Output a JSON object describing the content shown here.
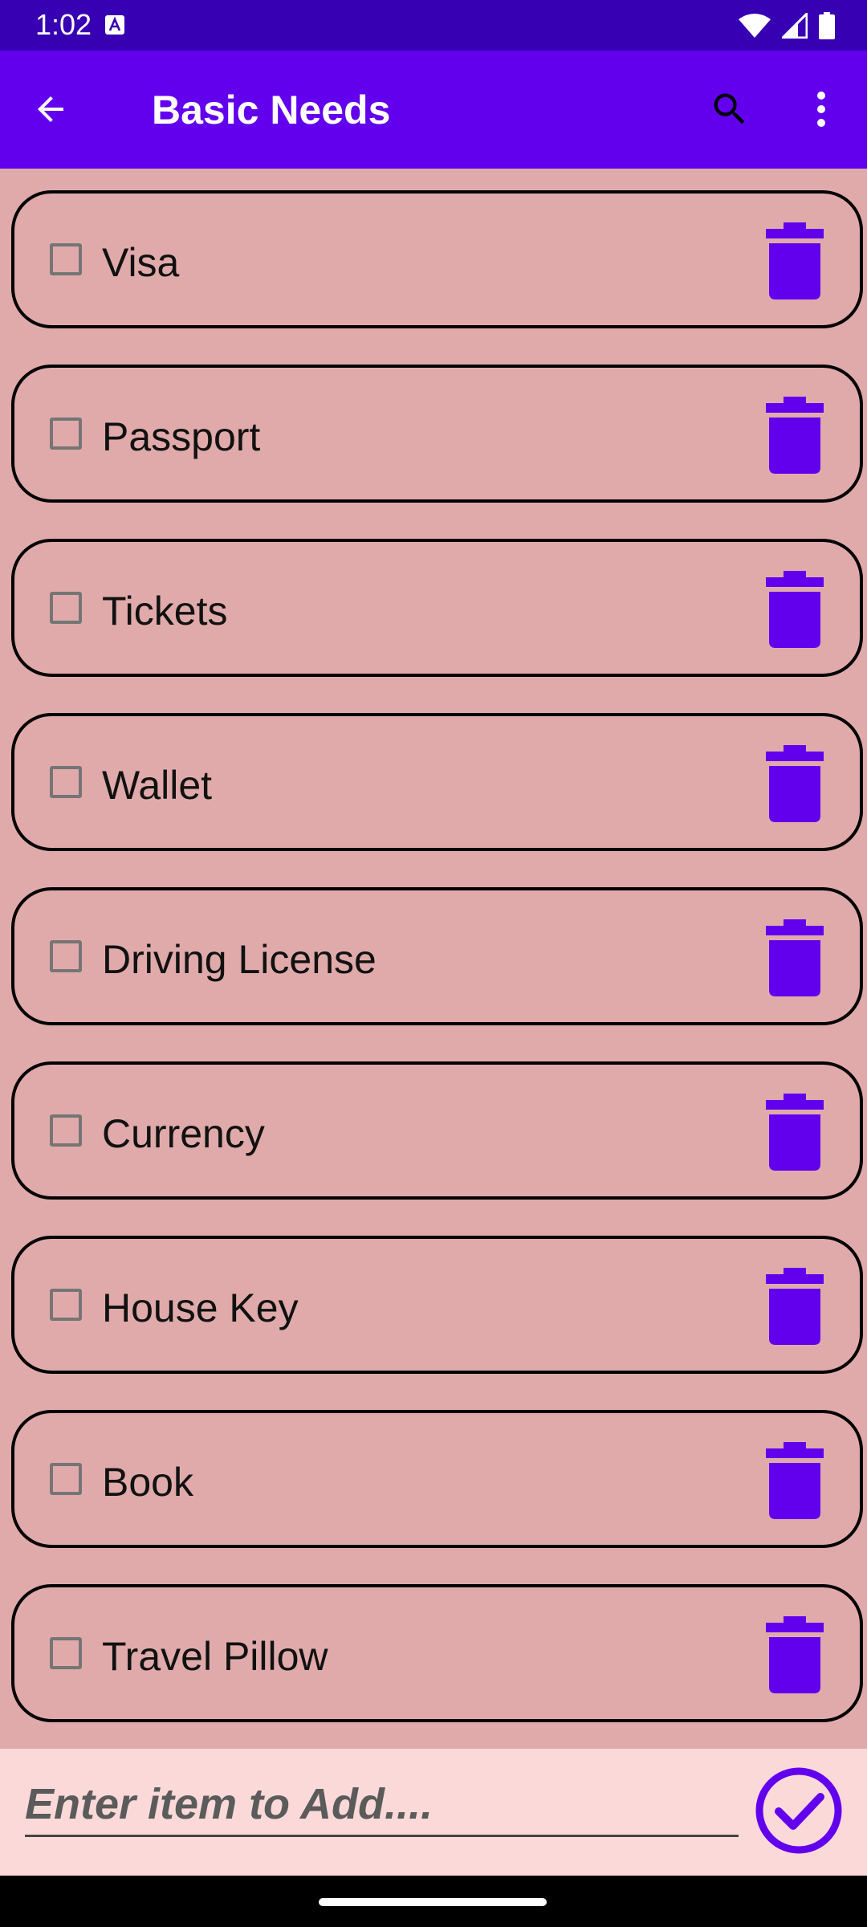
{
  "status_bar": {
    "time": "1:02"
  },
  "app_bar": {
    "title": "Basic Needs",
    "back_icon": "arrow-back-icon",
    "search_icon": "search-icon",
    "more_icon": "more-vert-icon"
  },
  "items": [
    {
      "label": "Visa",
      "checked": false
    },
    {
      "label": "Passport",
      "checked": false
    },
    {
      "label": "Tickets",
      "checked": false
    },
    {
      "label": "Wallet",
      "checked": false
    },
    {
      "label": "Driving License",
      "checked": false
    },
    {
      "label": "Currency",
      "checked": false
    },
    {
      "label": "House Key",
      "checked": false
    },
    {
      "label": "Book",
      "checked": false
    },
    {
      "label": "Travel Pillow",
      "checked": false
    }
  ],
  "add_item": {
    "placeholder": "Enter item to Add....",
    "value": ""
  },
  "colors": {
    "status_bar": "#3700b3",
    "app_bar": "#6200ee",
    "background": "#e0aaab",
    "accent": "#6200ee",
    "bottom_bar": "#fcd9d9"
  }
}
